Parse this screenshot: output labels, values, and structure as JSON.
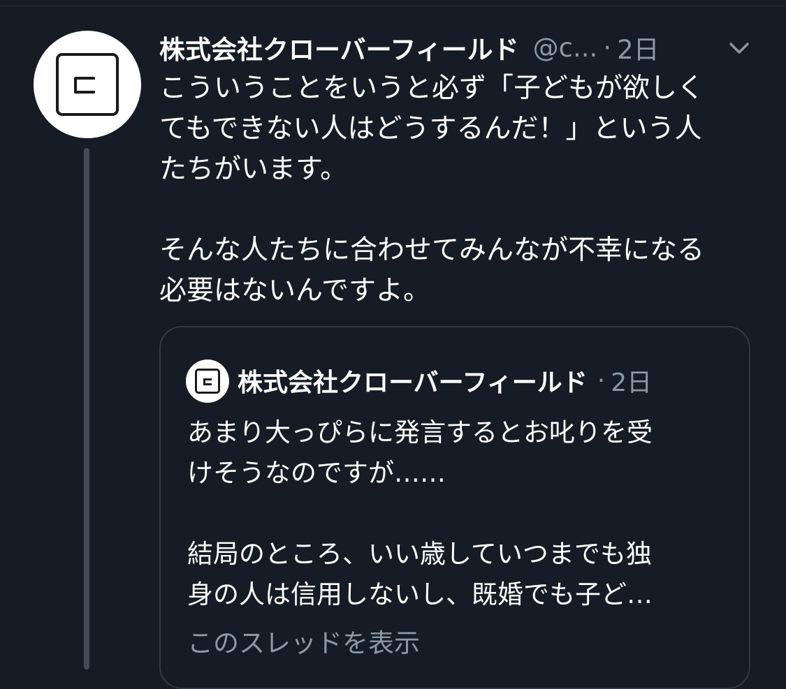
{
  "tweet": {
    "display_name": "株式会社クローバーフィールド",
    "handle": "@c...",
    "separator": "·",
    "time": "2日",
    "text": "こういうことをいうと必ず「子どもが欲しく\nてもできない人はどうするんだ！」という人\nたちがいます。\n\nそんな人たちに合わせてみんなが不幸になる\n必要はないんですよ。",
    "menu_icon": "chevron-down-icon",
    "avatar_icon": "clover-field-logo"
  },
  "quoted_tweet": {
    "display_name": "株式会社クローバーフィールド",
    "separator": "·",
    "time": "2日",
    "text": "あまり大っぴらに発言するとお叱りを受\nけそうなのですが……\n\n結局のところ、いい歳していつまでも独\n身の人は信用しないし、既婚でも子ど…",
    "show_thread_label": "このスレッドを表示"
  },
  "colors": {
    "background": "#161c25",
    "primary_text": "#ffffff",
    "secondary_text": "#8b98a5",
    "thread_line": "#414b59",
    "card_border": "#2f3a45"
  }
}
